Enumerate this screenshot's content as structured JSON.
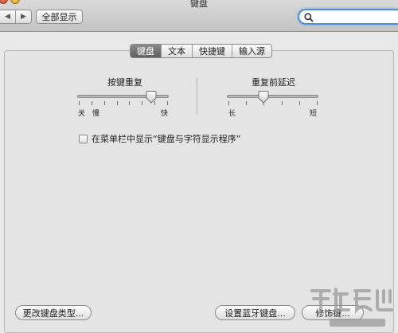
{
  "window": {
    "title": "键盘"
  },
  "toolbar": {
    "back_icon": "chevron-left-icon",
    "forward_icon": "chevron-right-icon",
    "show_all_label": "全部显示",
    "search_icon": "search-icon",
    "search_value": ""
  },
  "tabs": [
    {
      "label": "键盘",
      "active": true
    },
    {
      "label": "文本",
      "active": false
    },
    {
      "label": "快捷键",
      "active": false
    },
    {
      "label": "输入源",
      "active": false
    }
  ],
  "key_repeat": {
    "label": "按键重复",
    "min_labels": [
      "关",
      "慢"
    ],
    "max_label": "快",
    "value_fraction": 0.81
  },
  "delay_until_repeat": {
    "label": "重复前延迟",
    "min_label": "长",
    "max_label": "短",
    "value_fraction": 0.4
  },
  "menu_bar_option": {
    "label": "在菜单栏中显示“键盘与字符显示程序”",
    "checked": false
  },
  "buttons": {
    "change_keyboard_type": "更改键盘类型...",
    "setup_bluetooth_keyboard": "设置蓝牙键盘...",
    "modifier_keys": "修饰键..."
  },
  "colors": {
    "accent": "#4f8fd9",
    "active_tab": "#6e6e6e"
  }
}
